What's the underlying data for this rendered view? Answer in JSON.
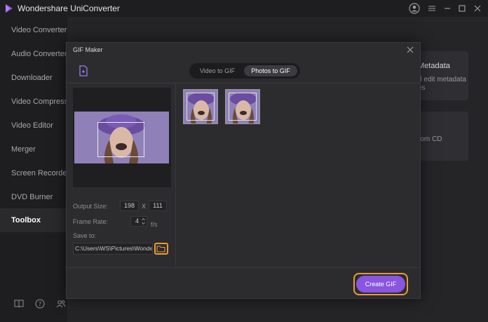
{
  "app": {
    "title": "Wondershare UniConverter",
    "accent_color": "#8a55e0",
    "highlight_color": "#e89a3c"
  },
  "window_controls": {
    "icons": [
      "user-icon",
      "menu-icon",
      "minimize-icon",
      "maximize-icon",
      "close-icon"
    ]
  },
  "sidebar": {
    "items": [
      {
        "label": "Video Converter",
        "active": false
      },
      {
        "label": "Audio Converter",
        "active": false
      },
      {
        "label": "Downloader",
        "active": false
      },
      {
        "label": "Video Compressor",
        "active": false
      },
      {
        "label": "Video Editor",
        "active": false
      },
      {
        "label": "Merger",
        "active": false
      },
      {
        "label": "Screen Recorder",
        "active": false
      },
      {
        "label": "DVD Burner",
        "active": false
      },
      {
        "label": "Toolbox",
        "active": true
      }
    ],
    "bottom_icons": [
      "book-icon",
      "help-icon",
      "community-icon"
    ]
  },
  "background_cards": {
    "metadata_title": "Metadata",
    "metadata_desc_1": "d edit metadata",
    "metadata_desc_2": "es",
    "cd_title": "r",
    "cd_desc": "rom CD"
  },
  "gif_maker": {
    "title": "GIF Maker",
    "tabs": [
      {
        "label": "Video to GIF",
        "active": false
      },
      {
        "label": "Photos to GIF",
        "active": true
      }
    ],
    "output_size_label": "Output Size:",
    "width": "198",
    "size_separator": "X",
    "height": "111",
    "frame_rate_label": "Frame Rate:",
    "frame_rate": "4",
    "frame_rate_unit": "f/s",
    "save_to_label": "Save to:",
    "save_path": "C:\\Users\\WS\\Pictures\\Wonde",
    "create_button": "Create GIF",
    "photo_count": 2
  }
}
